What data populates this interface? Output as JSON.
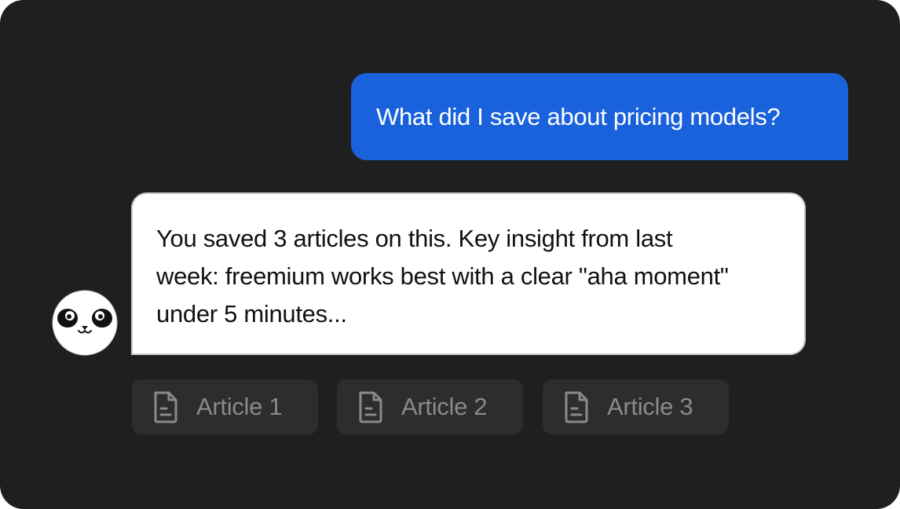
{
  "chat": {
    "user_message": "What did I save about pricing models?",
    "assistant_message": "You saved 3 articles on this. Key insight from last week: freemium works best with a clear \"aha moment\" under 5 minutes...",
    "assistant_avatar_icon": "panda-face-icon"
  },
  "sources": [
    {
      "label": "Article 1",
      "icon": "document-icon"
    },
    {
      "label": "Article 2",
      "icon": "document-icon"
    },
    {
      "label": "Article 3",
      "icon": "document-icon"
    }
  ],
  "colors": {
    "background": "#1f1f1f",
    "user_bubble": "#1a62dc",
    "assistant_bubble": "#ffffff",
    "chip_background": "#2d2d2d",
    "chip_text": "#8a8a8a"
  }
}
